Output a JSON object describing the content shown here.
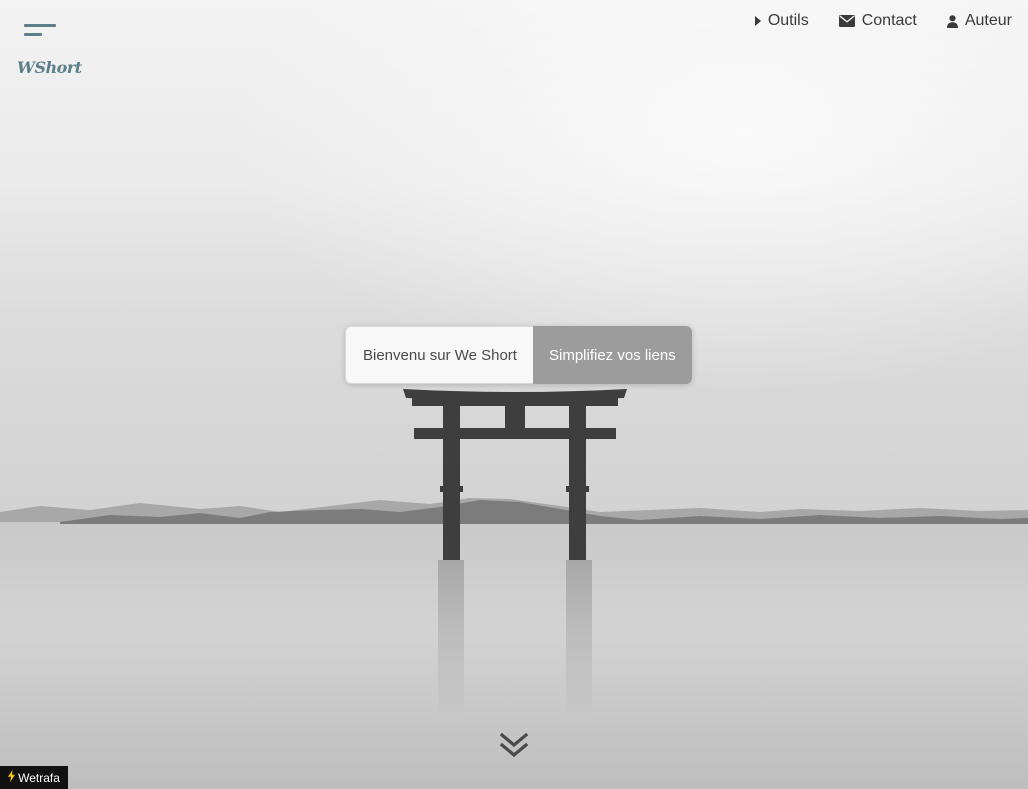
{
  "brand": {
    "logo_text": "WShort",
    "accent_color": "#5c7f8a"
  },
  "nav": {
    "items": [
      {
        "label": "Outils",
        "icon": "caret-right-icon"
      },
      {
        "label": "Contact",
        "icon": "envelope-icon"
      },
      {
        "label": "Auteur",
        "icon": "user-icon"
      }
    ]
  },
  "hero": {
    "welcome_text": "Bienvenu sur We Short",
    "cta_label": "Simplifiez vos liens"
  },
  "scroll": {
    "icon": "double-chevron-down-icon"
  },
  "footer": {
    "badge_label": "Wetrafa",
    "badge_icon": "lightning-bolt-icon"
  }
}
